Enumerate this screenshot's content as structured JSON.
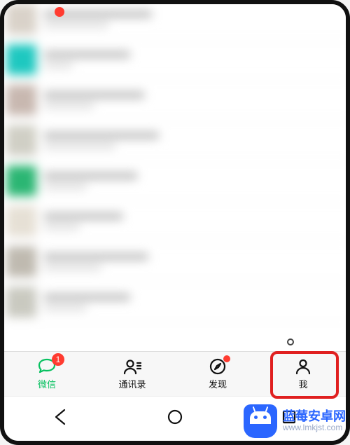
{
  "tabs": {
    "chats": {
      "label": "微信",
      "active": true,
      "badge_count": "1"
    },
    "contacts": {
      "label": "通讯录",
      "active": false
    },
    "discover": {
      "label": "发现",
      "active": false,
      "dot": true
    },
    "me": {
      "label": "我",
      "active": false,
      "highlighted": true
    }
  },
  "chat_rows": [
    {
      "avatar_color": "#d9d2c9",
      "w1": 150,
      "w2": 90
    },
    {
      "avatar_color": "#1ec8c0",
      "w1": 120,
      "w2": 40
    },
    {
      "avatar_color": "#c8b8b0",
      "w1": 140,
      "w2": 70
    },
    {
      "avatar_color": "#d0cfc5",
      "w1": 160,
      "w2": 100
    },
    {
      "avatar_color": "#2bb673",
      "w1": 130,
      "w2": 60
    },
    {
      "avatar_color": "#e6e0d5",
      "w1": 110,
      "w2": 50
    },
    {
      "avatar_color": "#bfbab0",
      "w1": 145,
      "w2": 80
    },
    {
      "avatar_color": "#c9c9c0",
      "w1": 120,
      "w2": 60
    }
  ],
  "watermark": {
    "title": "蓝莓安卓网",
    "url": "www.lmkjst.com"
  },
  "colors": {
    "accent": "#07c160",
    "badge": "#ff3b30",
    "highlight": "#e02020",
    "watermark_brand": "#2b66ff"
  }
}
